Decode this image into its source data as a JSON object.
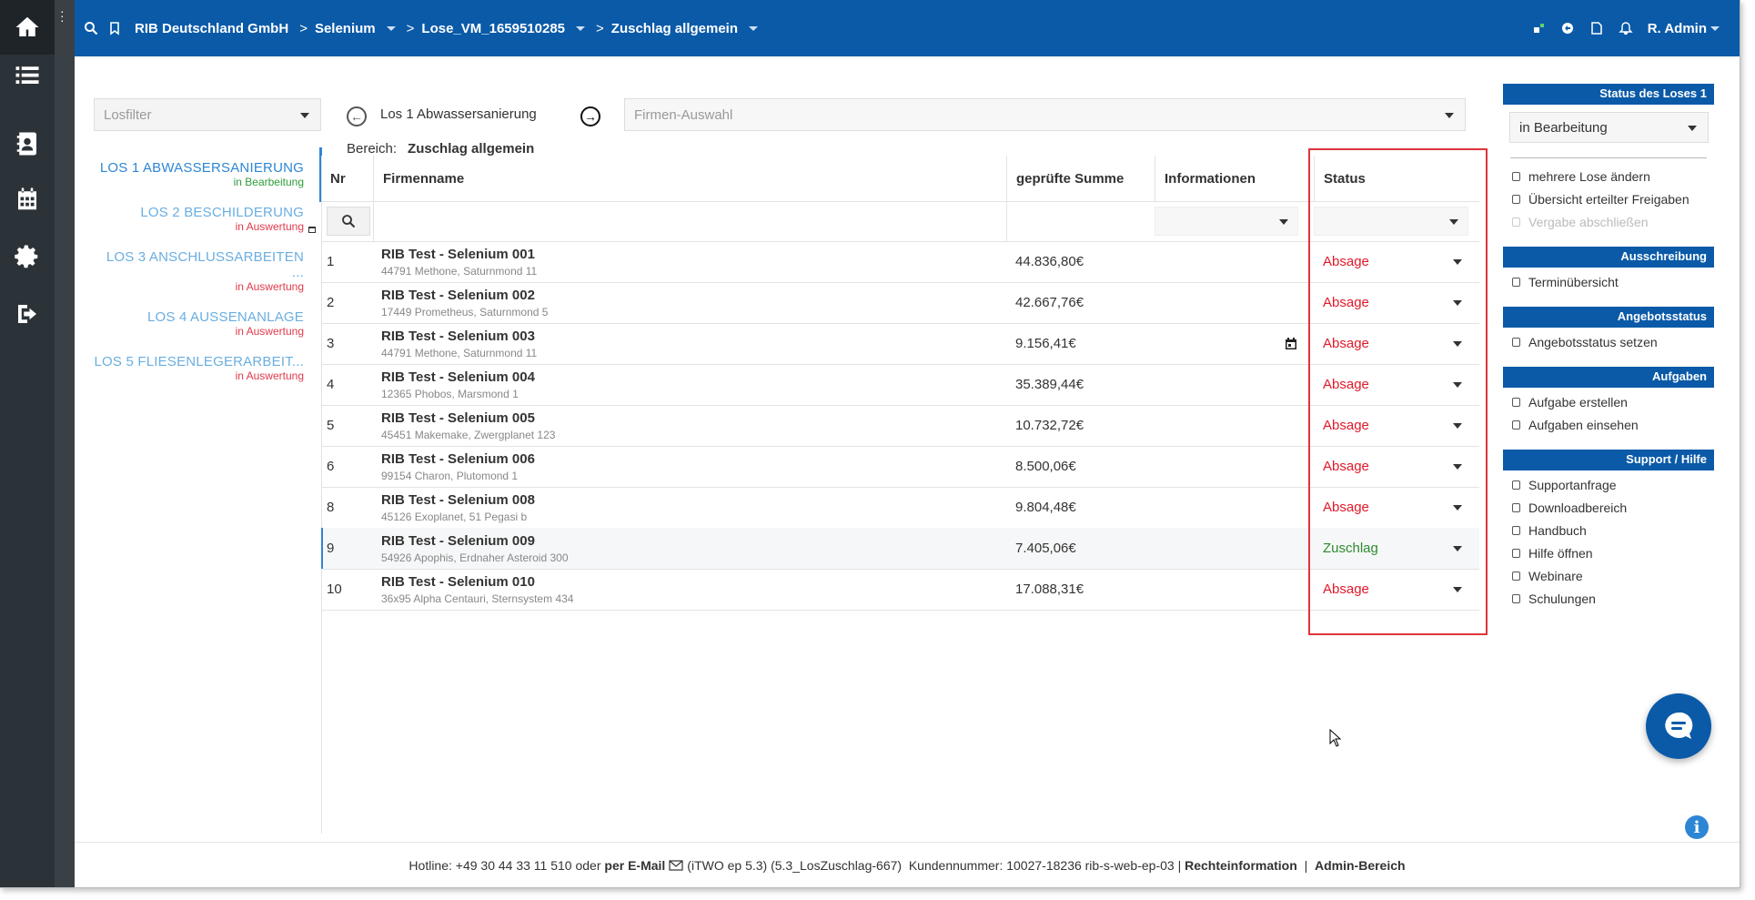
{
  "topbar": {
    "company": "RIB Deutschland GmbH",
    "project": "Selenium",
    "lose": "Lose_VM_1659510285",
    "page": "Zuschlag allgemein",
    "user": "R. Admin"
  },
  "filter": {
    "losfilter_placeholder": "Losfilter",
    "firmen_placeholder": "Firmen-Auswahl"
  },
  "lots": [
    {
      "name": "LOS 1 ABWASSERSANIERUNG",
      "state": "in Bearbeitung"
    },
    {
      "name": "LOS 2 BESCHILDERUNG",
      "state": "in Auswertung"
    },
    {
      "name": "LOS 3 ANSCHLUSSARBEITEN ...",
      "state": "in Auswertung"
    },
    {
      "name": "LOS 4 AUSSENANLAGE",
      "state": "in Auswertung"
    },
    {
      "name": "LOS 5 FLIESENLEGERARBEIT...",
      "state": "in Auswertung"
    }
  ],
  "current_lot": "Los 1 Abwassersanierung",
  "bereich": {
    "label": "Bereich:",
    "value": "Zuschlag allgemein"
  },
  "table": {
    "headers": {
      "nr": "Nr",
      "firm": "Firmenname",
      "sum": "geprüfte Summe",
      "info": "Informationen",
      "status": "Status"
    },
    "rows": [
      {
        "nr": "1",
        "firm": "RIB Test - Selenium 001",
        "addr": "44791 Methone, Saturnmond 11",
        "sum": "44.836,80€",
        "status": "Absage"
      },
      {
        "nr": "2",
        "firm": "RIB Test - Selenium 002",
        "addr": "17449 Prometheus, Saturnmond 5",
        "sum": "42.667,76€",
        "status": "Absage"
      },
      {
        "nr": "3",
        "firm": "RIB Test - Selenium 003",
        "addr": "44791 Methone, Saturnmond 11",
        "sum": "9.156,41€",
        "status": "Absage"
      },
      {
        "nr": "4",
        "firm": "RIB Test - Selenium 004",
        "addr": "12365 Phobos, Marsmond 1",
        "sum": "35.389,44€",
        "status": "Absage"
      },
      {
        "nr": "5",
        "firm": "RIB Test - Selenium 005",
        "addr": "45451 Makemake, Zwergplanet 123",
        "sum": "10.732,72€",
        "status": "Absage"
      },
      {
        "nr": "6",
        "firm": "RIB Test - Selenium 006",
        "addr": "99154 Charon, Plutomond 1",
        "sum": "8.500,06€",
        "status": "Absage"
      },
      {
        "nr": "8",
        "firm": "RIB Test - Selenium 008",
        "addr": "45126 Exoplanet, 51 Pegasi b",
        "sum": "9.804,48€",
        "status": "Absage"
      },
      {
        "nr": "9",
        "firm": "RIB Test - Selenium 009",
        "addr": "54926 Apophis, Erdnaher Asteroid 300",
        "sum": "7.405,06€",
        "status": "Zuschlag"
      },
      {
        "nr": "10",
        "firm": "RIB Test - Selenium 010",
        "addr": "36x95 Alpha Centauri, Sternsystem 434",
        "sum": "17.088,31€",
        "status": "Absage"
      }
    ]
  },
  "right_panel": {
    "status_head": "Status des Loses 1",
    "status_value": "in Bearbeitung",
    "links1": [
      "mehrere Lose ändern",
      "Übersicht erteilter Freigaben",
      "Vergabe abschließen"
    ],
    "ausschreibung_head": "Ausschreibung",
    "ausschreibung_links": [
      "Terminübersicht"
    ],
    "angebot_head": "Angebotsstatus",
    "angebot_links": [
      "Angebotsstatus setzen"
    ],
    "aufgaben_head": "Aufgaben",
    "aufgaben_links": [
      "Aufgabe erstellen",
      "Aufgaben einsehen"
    ],
    "support_head": "Support / Hilfe",
    "support_links": [
      "Supportanfrage",
      "Downloadbereich",
      "Handbuch",
      "Hilfe öffnen",
      "Webinare",
      "Schulungen"
    ]
  },
  "footer": {
    "hotline": "Hotline: +49 30 44 33 11 510 oder",
    "email": "per E-Mail",
    "version": "(iTWO ep 5.3) (5.3_LosZuschlag-667)",
    "kunden": "Kundennummer: 10027-18236 rib-s-web-ep-03 |",
    "recht": "Rechteinformation",
    "sep": "|",
    "admin": "Admin-Bereich"
  },
  "colors": {
    "brand": "#0a5aa8",
    "absage": "#e0192a",
    "zuschlag": "#2e8b2e",
    "highlight": "#e0343a"
  }
}
